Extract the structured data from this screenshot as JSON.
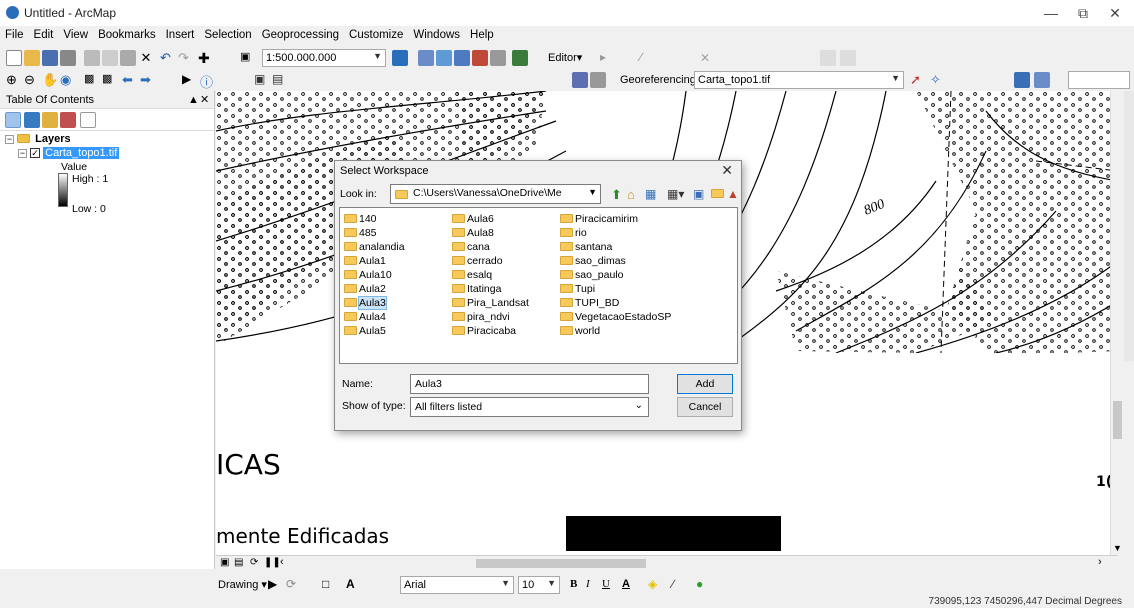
{
  "window": {
    "title": "Untitled - ArcMap"
  },
  "menu": [
    "File",
    "Edit",
    "View",
    "Bookmarks",
    "Insert",
    "Selection",
    "Geoprocessing",
    "Customize",
    "Windows",
    "Help"
  ],
  "toolbar": {
    "scale": "1:500.000.000",
    "editor_label": "Editor▾",
    "georef_label": "Georeferencing ▾",
    "georef_layer": "Carta_topo1.tif"
  },
  "toc": {
    "title": "Table Of Contents",
    "layers_label": "Layers",
    "layer_name": "Carta_topo1.tif",
    "value_label": "Value",
    "high_label": "High : 1",
    "low_label": "Low : 0"
  },
  "map": {
    "text_icas": "ICAS",
    "text_edificadas": "mente  Edificadas",
    "contour_label": "800",
    "text_right": "1("
  },
  "dialog": {
    "title": "Select Workspace",
    "lookin_label": "Look in:",
    "lookin_path": "C:\\Users\\Vanessa\\OneDrive\\Me",
    "folders_col1": [
      "140",
      "485",
      "analandia",
      "Aula1",
      "Aula10",
      "Aula2",
      "Aula3",
      "Aula4",
      "Aula5"
    ],
    "folders_col2": [
      "Aula6",
      "Aula8",
      "cana",
      "cerrado",
      "esalq",
      "Itatinga",
      "Pira_Landsat",
      "pira_ndvi",
      "Piracicaba"
    ],
    "folders_col3": [
      "Piracicamirim",
      "rio",
      "santana",
      "sao_dimas",
      "sao_paulo",
      "Tupi",
      "TUPI_BD",
      "VegetacaoEstadoSP",
      "world"
    ],
    "selected": "Aula3",
    "name_label": "Name:",
    "name_value": "Aula3",
    "type_label": "Show of type:",
    "type_value": "All filters listed",
    "add_button": "Add",
    "cancel_button": "Cancel"
  },
  "drawing": {
    "drawing_label": "Drawing ▾",
    "font_name": "Arial",
    "font_size": "10",
    "bold": "B",
    "italic": "I",
    "underline": "U",
    "font_color": "A"
  },
  "status": {
    "coords": "739095,123  7450296,447 Decimal Degrees"
  }
}
